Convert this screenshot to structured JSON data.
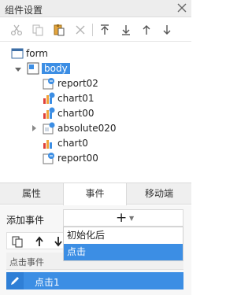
{
  "panel": {
    "title": "组件设置"
  },
  "toolbar": {
    "items": [
      "cut-icon",
      "copy-icon",
      "paste-icon",
      "delete-icon",
      "move-top-icon",
      "move-bottom-icon",
      "move-up-icon",
      "move-down-icon"
    ]
  },
  "tree": {
    "root": "form",
    "body": "body",
    "children": [
      "report02",
      "chart01",
      "chart00",
      "absolute020",
      "chart0",
      "report00"
    ]
  },
  "tabs": {
    "properties": "属性",
    "events": "事件",
    "mobile": "移动端"
  },
  "events": {
    "add_label": "添加事件",
    "add_plus": "+",
    "dropdown": [
      "初始化后",
      "点击"
    ],
    "list_header": "点击事件",
    "row_label": "点击1"
  },
  "colors": {
    "accent": "#3c8ee4",
    "header_bg": "#ededed"
  }
}
